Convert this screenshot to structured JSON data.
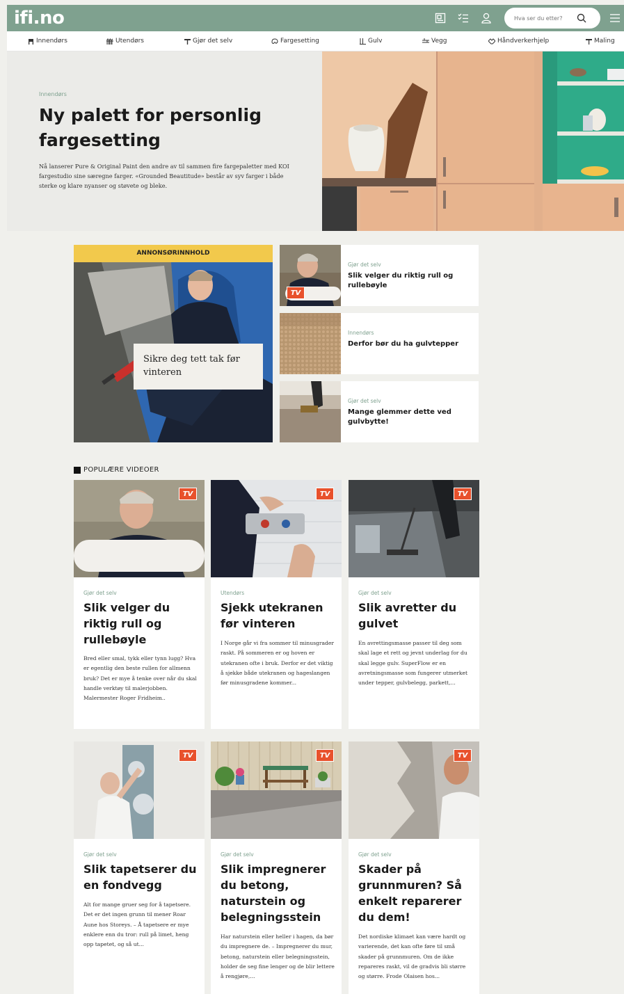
{
  "header": {
    "logo": "ifi.no",
    "search_placeholder": "Hva ser du etter?"
  },
  "nav": [
    {
      "label": "Innendørs",
      "icon": "chair-icon"
    },
    {
      "label": "Utendørs",
      "icon": "fence-icon"
    },
    {
      "label": "Gjør det selv",
      "icon": "hammer-icon"
    },
    {
      "label": "Fargesetting",
      "icon": "palette-icon"
    },
    {
      "label": "Gulv",
      "icon": "floor-icon"
    },
    {
      "label": "Vegg",
      "icon": "wall-icon"
    },
    {
      "label": "Håndverkerhjelp",
      "icon": "handshake-icon"
    },
    {
      "label": "Maling",
      "icon": "paint-roller-icon"
    }
  ],
  "hero": {
    "category": "Innendørs",
    "title": "Ny palett for personlig fargesetting",
    "text": "Nå lanserer Pure & Original Paint den andre av til sammen fire fargepaletter med KOI fargestudio sine særegne farger. «Grounded Beautitude» består av syv farger i både sterke og klare nyanser og støvete og bleke."
  },
  "ad": {
    "band": "ANNONSØRINNHOLD",
    "caption": "Sikre deg tett tak før vinteren"
  },
  "side_cards": [
    {
      "category": "Gjør det selv",
      "title": "Slik velger du riktig rull og rullebøyle",
      "tv": "TV"
    },
    {
      "category": "Innendørs",
      "title": "Derfor bør du ha gulvtepper"
    },
    {
      "category": "Gjør det selv",
      "title": "Mange glemmer dette ved gulvbytte!"
    }
  ],
  "section": {
    "label": "POPULÆRE VIDEOER"
  },
  "videos": [
    {
      "category": "Gjør det selv",
      "title": "Slik velger du riktig rull og rullebøyle",
      "text": "Bred eller smal, tykk eller tynn lugg? Hva er egentlig den beste rullen for allmenn bruk? Det er mye å tenke over når du skal handle verktøy til malerjobben. Malermester Roger Fridheim..",
      "tv": "TV"
    },
    {
      "category": "Utendørs",
      "title": "Sjekk utekranen før vinteren",
      "text": "I Norge går vi fra sommer til minusgrader raskt. På sommeren er og hoven er utekranen ofte i bruk. Derfor er det viktig å sjekke både utekranen og hageslangen før minusgradene kommer...",
      "tv": "TV"
    },
    {
      "category": "Gjør det selv",
      "title": "Slik avretter du gulvet",
      "text": "En avrettingsmasse passer til deg som skal lage et rett og jevnt underlag for du skal legge gulv. SuperFlow er en avretningsmasse som fungerer utmerket under tepper, gulvbelegg, parkett,...",
      "tv": "TV"
    },
    {
      "category": "Gjør det selv",
      "title": "Slik tapetserer du en fondvegg",
      "text": "Alt for mange gruer seg for å tapetsere. Det er det ingen grunn til mener Roar Aune hos Storeys. – Å tapetsere er mye enklere enn du tror: rull på limet, heng opp tapetet, og så ut...",
      "tv": "TV"
    },
    {
      "category": "Gjør det selv",
      "title": "Slik impregnerer du betong, naturstein og belegningsstein",
      "text": "Har naturstein eller heller i hagen, da bør du impregnere de. – Impregnerer du mur, betong, naturstein eller belegningsstein, holder de seg fine lenger og de blir lettere å rengjøre,...",
      "tv": "TV"
    },
    {
      "category": "Gjør det selv",
      "title": "Skader på grunnmuren? Så enkelt reparerer du dem!",
      "text": "Det nordiske klimaet kan være hardt og varierende, det kan ofte føre til små skader på grunnmuren. Om de ikke repareres raskt, vil de gradvis bli større og større. Frode Olaisen hos...",
      "tv": "TV"
    }
  ]
}
